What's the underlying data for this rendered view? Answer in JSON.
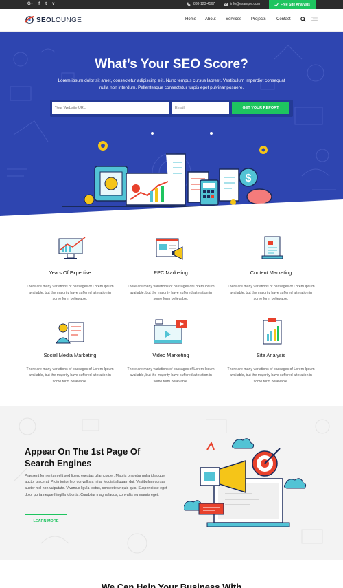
{
  "topbar": {
    "social": [
      "G+",
      "f",
      "t",
      "v"
    ],
    "phone": "888-123-4567",
    "email": "info@example.com",
    "cta_label": "Free Site Analysis"
  },
  "header": {
    "logo_seo": "SEO",
    "logo_lounge": "LOUNGE",
    "nav": [
      "Home",
      "About",
      "Services",
      "Projects",
      "Contact"
    ]
  },
  "hero": {
    "title": "What’s Your SEO Score?",
    "text": "Lorem ipsum dolor sit amet, consectetur adipiscing elit. Nunc tempus cursus laoreet. Vestibulum imperdiet consequat nulla non interdum. Pellentesque consectetur turpis eget pulvinar posuere.",
    "url_placeholder": "Your Website URL",
    "email_placeholder": "Email",
    "button_label": "GET YOUR REPORT"
  },
  "features": [
    {
      "title": "Years Of Expertise",
      "text": "There are many variations of passages of Lorem Ipsum available, but the majority have suffered alteration in some form believable.",
      "icon": "chart-monitor-icon"
    },
    {
      "title": "PPC Marketing",
      "text": "There are many variations of passages of Lorem Ipsum available, but the majority have suffered alteration in some form believable.",
      "icon": "megaphone-browser-icon"
    },
    {
      "title": "Content Marketing",
      "text": "There are many variations of passages of Lorem Ipsum available, but the majority have suffered alteration in some form believable.",
      "icon": "document-stack-icon"
    },
    {
      "title": "Social Media Marketing",
      "text": "There are many variations of passages of Lorem Ipsum available, but the majority have suffered alteration in some form believable.",
      "icon": "person-board-icon"
    },
    {
      "title": "Video Marketing",
      "text": "There are many variations of passages of Lorem Ipsum available, but the majority have suffered alteration in some form believable.",
      "icon": "video-player-icon"
    },
    {
      "title": "Site Analysis",
      "text": "There are many variations of passages of Lorem Ipsum available, but the majority have suffered alteration in some form believable.",
      "icon": "clipboard-chart-icon"
    }
  ],
  "seo_section": {
    "title_line1": "Appear On The 1st Page Of",
    "title_line2": "Search Engines",
    "text": "Praesent fermentum elit sed libero egestas ullamcorper. Mauris pharetra nulla id augue auctor placerat. Proin tortor leo, convallis a mi a, feugiat aliquam dui. Vestibulum cursus auctor nisl non vulputate. Vivamus ligula lectus, consectetur quis quis. Suspendisse eget dolor porta neque fringilla lobortis. Curabitur magna lacus, convallis eu mauris eget.",
    "button_label": "LEARN MORE"
  },
  "next_heading": "We Can Help Your Business With",
  "colors": {
    "accent_green": "#1ec45f",
    "hero_blue": "#2e45b0",
    "topbar_dark": "#2c2c2c"
  }
}
